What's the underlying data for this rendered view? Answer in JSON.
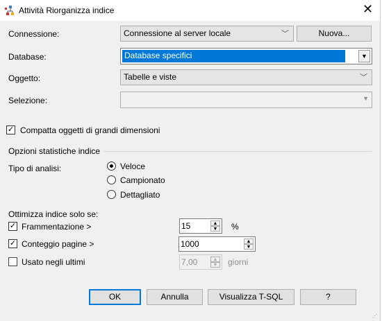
{
  "window": {
    "title": "Attività Riorganizza indice",
    "close": "✕"
  },
  "connection": {
    "label": "Connessione:",
    "value": "Connessione al server locale",
    "new_button": "Nuova..."
  },
  "database": {
    "label": "Database:",
    "value": "Database specifici"
  },
  "object": {
    "label": "Oggetto:",
    "value": "Tabelle e viste"
  },
  "selection": {
    "label": "Selezione:",
    "value": ""
  },
  "compact": {
    "label": "Compatta oggetti di grandi dimensioni",
    "checked": true
  },
  "stats": {
    "group_title": "Opzioni statistiche indice",
    "scan_label": "Tipo di analisi:",
    "options": [
      "Veloce",
      "Campionato",
      "Dettagliato"
    ],
    "selected": "Veloce"
  },
  "optimize": {
    "title": "Ottimizza indice solo se:",
    "fragmentation": {
      "label": "Frammentazione >",
      "checked": true,
      "value": "15",
      "unit": "%"
    },
    "page_count": {
      "label": "Conteggio pagine >",
      "checked": true,
      "value": "1000"
    },
    "used_last": {
      "label": "Usato negli ultimi",
      "checked": false,
      "value": "7,00",
      "unit": "giorni"
    }
  },
  "buttons": {
    "ok": "OK",
    "cancel": "Annulla",
    "tsql": "Visualizza T-SQL",
    "help": "?"
  }
}
